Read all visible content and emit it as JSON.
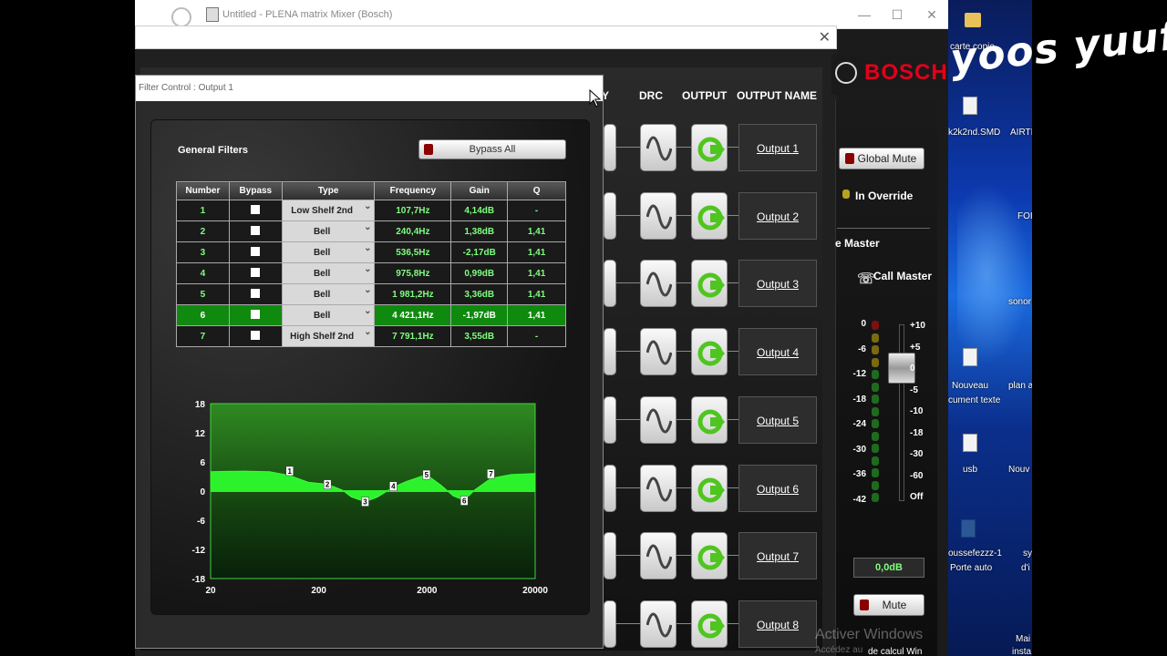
{
  "mixer_window": {
    "title": "Untitled - PLENA matrix Mixer (Bosch)",
    "minimize": "—",
    "maximize": "☐",
    "close": "✕",
    "inner_close": "✕"
  },
  "brand": {
    "logo_text": "BOSCH"
  },
  "overlay": {
    "text": "yoos yuuf"
  },
  "columns": {
    "partial": "Y",
    "drc": "DRC",
    "output": "OUTPUT",
    "output_name": "OUTPUT NAME"
  },
  "outputs": [
    {
      "name": "Output 1"
    },
    {
      "name": "Output 2"
    },
    {
      "name": "Output 3"
    },
    {
      "name": "Output 4"
    },
    {
      "name": "Output 5"
    },
    {
      "name": "Output 6"
    },
    {
      "name": "Output 7"
    },
    {
      "name": "Output 8"
    }
  ],
  "right_panel": {
    "global_mute": "Global Mute",
    "in_override": "In Override",
    "master_label": "e Master",
    "call_master": "Call Master",
    "meter_scale": [
      "0",
      "-6",
      "-12",
      "-18",
      "-24",
      "-30",
      "-36",
      "-42"
    ],
    "fader_scale": [
      "+10",
      "+5",
      "0",
      "-5",
      "-10",
      "-18",
      "-30",
      "-60",
      "Off"
    ],
    "gain": "0,0dB",
    "mute": "Mute",
    "fader_level_db": 0
  },
  "filter_dialog": {
    "title": "Filter Control : Output 1",
    "section": "General Filters",
    "bypass_all": "Bypass All",
    "headers": [
      "Number",
      "Bypass",
      "Type",
      "Frequency",
      "Gain",
      "Q"
    ],
    "rows": [
      {
        "number": "1",
        "type": "Low Shelf 2nd",
        "frequency": "107,7Hz",
        "gain": "4,14dB",
        "q": "-"
      },
      {
        "number": "2",
        "type": "Bell",
        "frequency": "240,4Hz",
        "gain": "1,38dB",
        "q": "1,41"
      },
      {
        "number": "3",
        "type": "Bell",
        "frequency": "536,5Hz",
        "gain": "-2,17dB",
        "q": "1,41"
      },
      {
        "number": "4",
        "type": "Bell",
        "frequency": "975,8Hz",
        "gain": "0,99dB",
        "q": "1,41"
      },
      {
        "number": "5",
        "type": "Bell",
        "frequency": "1 981,2Hz",
        "gain": "3,36dB",
        "q": "1,41"
      },
      {
        "number": "6",
        "type": "Bell",
        "frequency": "4 421,1Hz",
        "gain": "-1,97dB",
        "q": "1,41"
      },
      {
        "number": "7",
        "type": "High Shelf 2nd",
        "frequency": "7 791,1Hz",
        "gain": "3,55dB",
        "q": "-"
      }
    ],
    "selected_row": 5
  },
  "chart_data": {
    "type": "line",
    "x_scale": "log",
    "xlim": [
      20,
      20000
    ],
    "ylim": [
      -18,
      18
    ],
    "x_ticks": [
      "20",
      "200",
      "2000",
      "20000"
    ],
    "y_ticks": [
      "18",
      "12",
      "6",
      "0",
      "-6",
      "-12",
      "-18"
    ],
    "grid": false,
    "curve": [
      [
        20,
        4.0
      ],
      [
        40,
        4.1
      ],
      [
        70,
        4.0
      ],
      [
        107,
        3.2
      ],
      [
        160,
        1.8
      ],
      [
        240,
        1.4
      ],
      [
        330,
        0.2
      ],
      [
        400,
        -1.2
      ],
      [
        536,
        -2.2
      ],
      [
        700,
        -1.2
      ],
      [
        975,
        0.8
      ],
      [
        1300,
        2.0
      ],
      [
        1981,
        3.4
      ],
      [
        2700,
        1.2
      ],
      [
        3500,
        -1.0
      ],
      [
        4421,
        -1.9
      ],
      [
        5500,
        0.2
      ],
      [
        7791,
        2.6
      ],
      [
        12000,
        3.4
      ],
      [
        20000,
        3.6
      ]
    ],
    "markers": [
      {
        "label": "1",
        "freq": 107.7,
        "gain": 4.14
      },
      {
        "label": "2",
        "freq": 240.4,
        "gain": 1.38
      },
      {
        "label": "3",
        "freq": 536.5,
        "gain": -2.17
      },
      {
        "label": "4",
        "freq": 975.8,
        "gain": 0.99
      },
      {
        "label": "5",
        "freq": 1981.2,
        "gain": 3.36
      },
      {
        "label": "6",
        "freq": 4421.1,
        "gain": -1.97
      },
      {
        "label": "7",
        "freq": 7791.1,
        "gain": 3.55
      }
    ]
  },
  "desktop": {
    "icons": [
      {
        "label": "carte copie"
      },
      {
        "label": "k2k2nd.SMD"
      },
      {
        "label": "AIRTI"
      },
      {
        "label": "FOI"
      },
      {
        "label": "sonor"
      },
      {
        "label": "Nouveau"
      },
      {
        "label": "cument texte"
      },
      {
        "label": "plan a"
      },
      {
        "label": "usb"
      },
      {
        "label": "Nouv"
      },
      {
        "label": "oussefezzz-1"
      },
      {
        "label": "sy"
      },
      {
        "label": "Porte auto"
      },
      {
        "label": "d'i"
      },
      {
        "label": "Mai"
      },
      {
        "label": "insta"
      }
    ],
    "watermark": "Activer Windows",
    "watermark_sub": "Accédez au",
    "watermark_link": "de calcul Win"
  }
}
